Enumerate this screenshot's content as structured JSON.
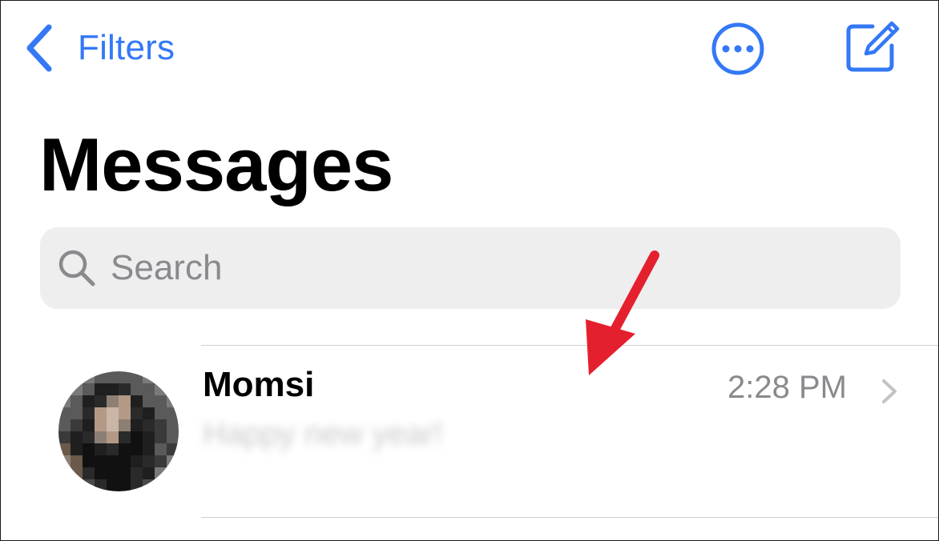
{
  "nav": {
    "back_label": "Filters",
    "back_icon": "chevron-left-icon",
    "more_icon": "ellipsis-circle-icon",
    "compose_icon": "compose-icon",
    "accent_color": "#3478f6"
  },
  "page_title": "Messages",
  "search": {
    "placeholder": "Search",
    "value": "",
    "icon": "magnifying-glass-icon"
  },
  "conversations": [
    {
      "name": "Momsi",
      "time": "2:28 PM",
      "preview": "Happy new year!",
      "preview_obscured": true,
      "avatar_obscured": true
    }
  ],
  "annotation": {
    "icon": "red-arrow",
    "color": "#e5202e"
  }
}
